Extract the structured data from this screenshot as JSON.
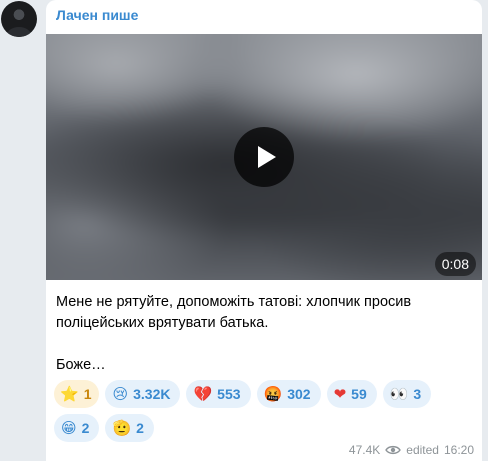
{
  "message": {
    "author": "Лачен пише",
    "video": {
      "duration": "0:08"
    },
    "caption": {
      "line1": "Мене не рятуйте, допоможіть татові: хлопчик просив",
      "line2": "поліцейських врятувати батька.",
      "line3": "Боже…"
    },
    "reactions": [
      {
        "icon": "⭐",
        "icon_name": "star-icon",
        "count": "1"
      },
      {
        "icon": "😢",
        "icon_name": "crying-face-icon",
        "count": "3.32K"
      },
      {
        "icon": "💔",
        "icon_name": "broken-heart-icon",
        "count": "553"
      },
      {
        "icon": "🤬",
        "icon_name": "angry-face-icon",
        "count": "302"
      },
      {
        "icon": "❤",
        "icon_name": "heart-icon",
        "count": "59"
      },
      {
        "icon": "👀",
        "icon_name": "eyes-icon",
        "count": "3"
      },
      {
        "icon": "😁",
        "icon_name": "grinning-face-icon",
        "count": "2"
      },
      {
        "icon": "🫡",
        "icon_name": "salute-face-icon",
        "count": "2"
      }
    ],
    "meta": {
      "views": "47.4K",
      "edited": "edited",
      "time": "16:20"
    }
  },
  "colors": {
    "accent": "#3a8ad0",
    "background": "#e7ebef",
    "bubble": "#ffffff"
  }
}
